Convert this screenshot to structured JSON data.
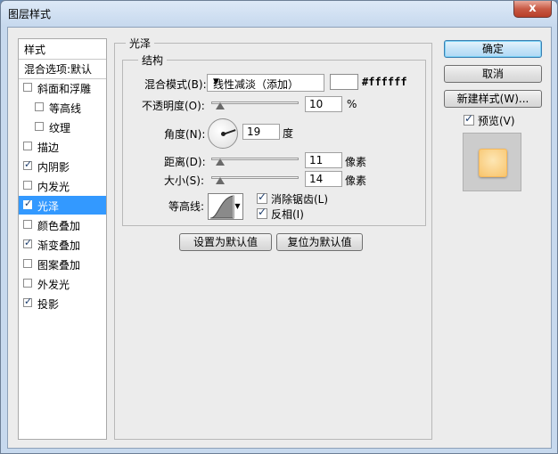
{
  "window": {
    "title": "图层样式",
    "close_label": "x"
  },
  "style_list": {
    "header": "样式",
    "blend_options": "混合选项:默认",
    "items": [
      {
        "label": "斜面和浮雕",
        "checked": false
      },
      {
        "label": "等高线",
        "checked": false
      },
      {
        "label": "纹理",
        "checked": false
      },
      {
        "label": "描边",
        "checked": false
      },
      {
        "label": "内阴影",
        "checked": true
      },
      {
        "label": "内发光",
        "checked": false
      },
      {
        "label": "光泽",
        "checked": true,
        "selected": true
      },
      {
        "label": "颜色叠加",
        "checked": false
      },
      {
        "label": "渐变叠加",
        "checked": true
      },
      {
        "label": "图案叠加",
        "checked": false
      },
      {
        "label": "外发光",
        "checked": false
      },
      {
        "label": "投影",
        "checked": true
      }
    ]
  },
  "satin": {
    "group_title": "光泽",
    "structure_title": "结构",
    "blend_mode_label": "混合模式(B):",
    "blend_mode_value": "线性减淡（添加）",
    "color_hex": "#ffffff",
    "opacity_label": "不透明度(O):",
    "opacity_value": "10",
    "opacity_unit": "%",
    "angle_label": "角度(N):",
    "angle_value": "19",
    "angle_unit": "度",
    "distance_label": "距离(D):",
    "distance_value": "11",
    "distance_unit": "像素",
    "size_label": "大小(S):",
    "size_value": "14",
    "size_unit": "像素",
    "contour_label": "等高线:",
    "antialias_label": "消除锯齿(L)",
    "antialias_checked": true,
    "invert_label": "反相(I)",
    "invert_checked": true,
    "make_default_label": "设置为默认值",
    "reset_default_label": "复位为默认值"
  },
  "actions": {
    "ok_label": "确定",
    "cancel_label": "取消",
    "new_style_label": "新建样式(W)...",
    "preview_label": "预览(V)",
    "preview_checked": true
  },
  "check_glyph": "✓",
  "arrow_glyph": "▼"
}
